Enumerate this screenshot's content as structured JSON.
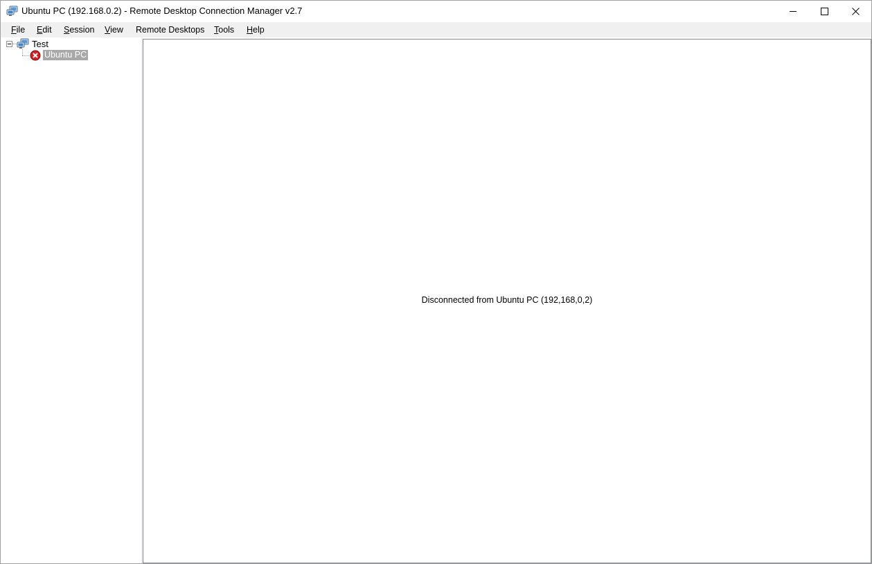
{
  "window": {
    "title": "Ubuntu PC (192.168.0.2) - Remote Desktop Connection Manager v2.7",
    "app_icon": "rdcman-icon",
    "controls": {
      "minimize_icon": "minimize-icon",
      "maximize_icon": "maximize-icon",
      "close_icon": "close-icon"
    }
  },
  "menu": {
    "items": [
      {
        "accel": "F",
        "rest": "ile"
      },
      {
        "accel": "E",
        "rest": "dit"
      },
      {
        "accel": "S",
        "rest": "ession"
      },
      {
        "accel": "V",
        "rest": "iew"
      },
      {
        "accel": "",
        "rest": "Remote Desktops"
      },
      {
        "accel": "T",
        "rest": "ools"
      },
      {
        "accel": "H",
        "rest": "elp"
      }
    ]
  },
  "tree": {
    "group": {
      "label": "Test",
      "icon": "server-group-icon",
      "expanded": true
    },
    "server": {
      "label": "Ubuntu PC",
      "icon": "disconnected-error-icon",
      "selected": true
    }
  },
  "content": {
    "status_message": "Disconnected from Ubuntu PC (192,168,0,2)"
  },
  "colors": {
    "selection_bg": "#a8a8a8",
    "menubar_bg": "#f0f0f0",
    "error_red": "#d32020"
  }
}
